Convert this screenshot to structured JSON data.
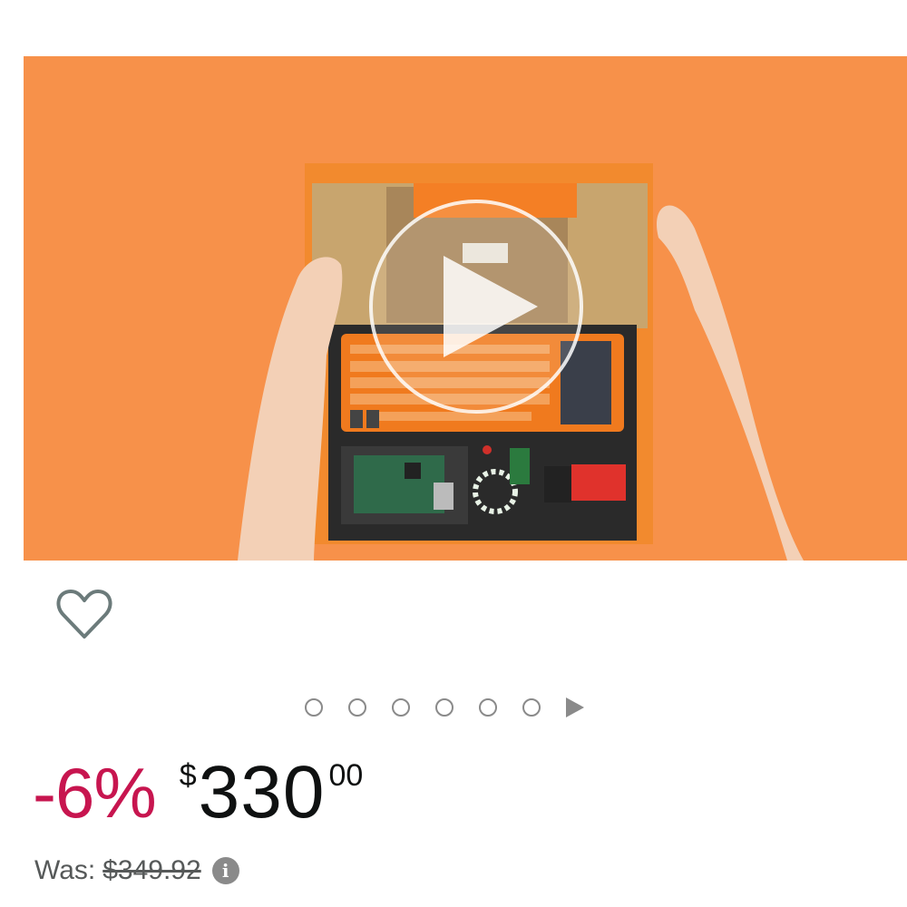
{
  "product": {
    "media": {
      "type": "video-thumbnail",
      "overlay_icon": "play-icon",
      "background_color": "#f7914a"
    },
    "wishlist_icon": "heart-outline-icon",
    "carousel": {
      "dot_count": 6,
      "active_index": 0,
      "next_icon": "chevron-right-triangle-icon"
    },
    "pricing": {
      "discount": "-6%",
      "currency_symbol": "$",
      "price_whole": "330",
      "price_fraction": "00",
      "was_label": "Was:",
      "was_price": "$349.92",
      "info_icon": "info-icon",
      "info_glyph": "i"
    },
    "colors": {
      "discount_red": "#c7154f",
      "price_text": "#0f1111",
      "muted_gray": "#565959"
    }
  }
}
